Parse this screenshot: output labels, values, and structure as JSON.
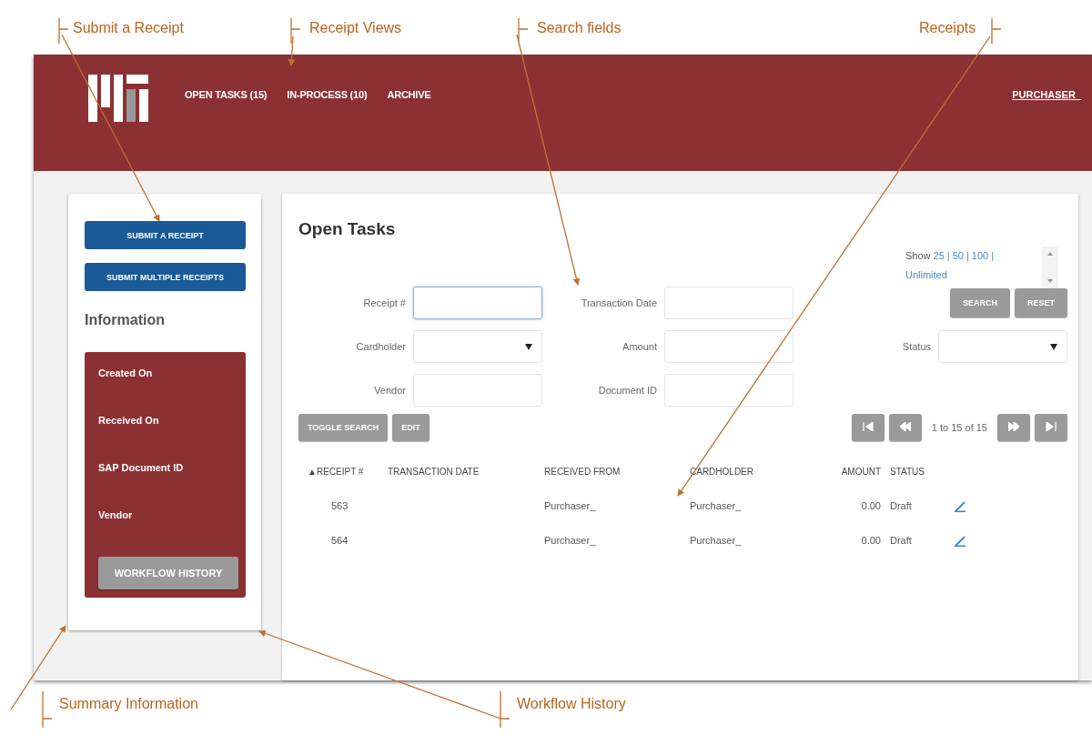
{
  "annotations": [
    {
      "label": "Submit a Receipt"
    },
    {
      "label": "Receipt Views"
    },
    {
      "label": "Search fields"
    },
    {
      "label": "Receipts"
    },
    {
      "label": "Summary Information"
    },
    {
      "label": "Workflow History"
    }
  ],
  "header": {
    "nav": [
      "OPEN TASKS (15)",
      "IN-PROCESS (10)",
      "ARCHIVE"
    ],
    "user": "PURCHASER_"
  },
  "sidebar": {
    "buttons": [
      "SUBMIT A RECEIPT",
      "SUBMIT MULTIPLE RECEIPTS"
    ],
    "heading": "Information",
    "fields": [
      "Created On",
      "Received On",
      "SAP Document ID",
      "Vendor"
    ],
    "history_button": "WORKFLOW HISTORY"
  },
  "main": {
    "title": "Open Tasks",
    "show": {
      "label": "Show",
      "options": [
        "25",
        "50",
        "100",
        "Unlimited"
      ],
      "separator": "|"
    },
    "search_buttons": [
      "SEARCH",
      "RESET"
    ],
    "fields": [
      {
        "label": "Receipt #",
        "kind": "text",
        "focused": true
      },
      {
        "label": "Transaction Date",
        "kind": "text",
        "focused": false
      },
      {
        "label": "Cardholder",
        "kind": "select",
        "focused": false
      },
      {
        "label": "Amount",
        "kind": "text",
        "focused": false
      },
      {
        "label": "Status",
        "kind": "select",
        "focused": false
      },
      {
        "label": "Vendor",
        "kind": "text",
        "focused": false
      },
      {
        "label": "Document ID",
        "kind": "text",
        "focused": false
      }
    ],
    "actions": [
      "TOGGLE SEARCH",
      "EDIT"
    ],
    "pagination": "1 to 15 of 15",
    "table": {
      "sort_mark": "▲",
      "columns": [
        "RECEIPT #",
        "TRANSACTION DATE",
        "RECEIVED FROM",
        "CARDHOLDER",
        "AMOUNT",
        "STATUS"
      ],
      "rows": [
        [
          "563",
          "",
          "Purchaser_",
          "Purchaser_",
          "0.00",
          "Draft"
        ],
        [
          "564",
          "",
          "Purchaser_",
          "Purchaser_",
          "0.00",
          "Draft"
        ]
      ]
    }
  }
}
